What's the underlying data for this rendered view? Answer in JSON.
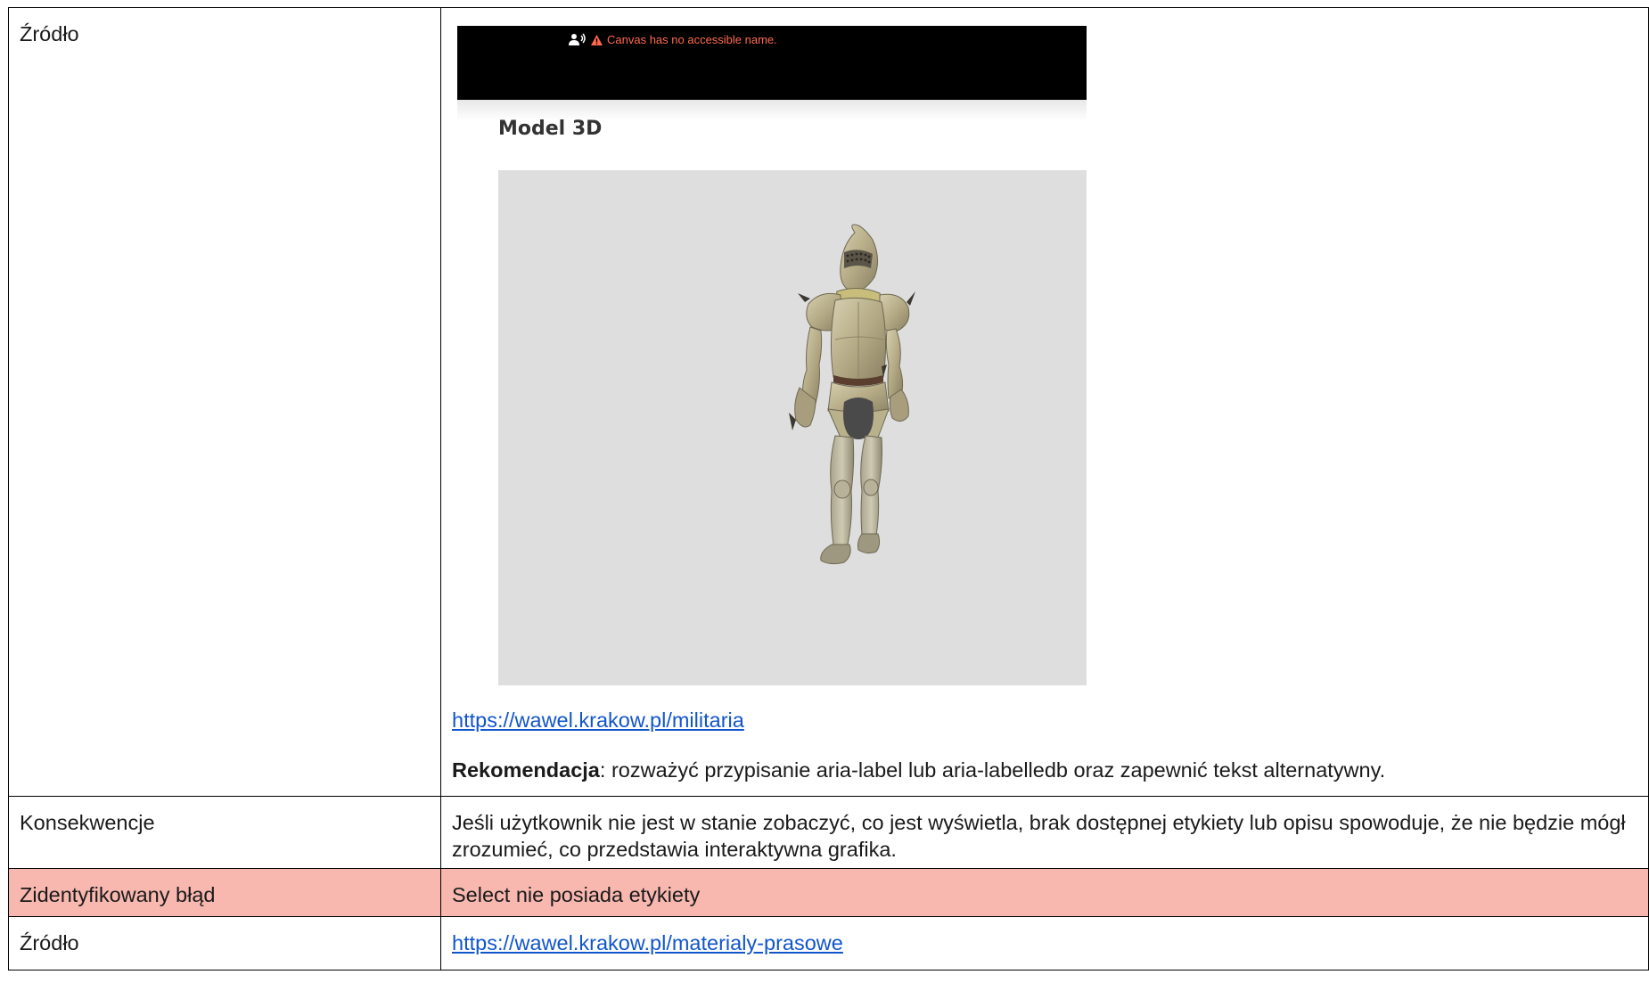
{
  "rows": [
    {
      "label": "Źródło",
      "screenshot": {
        "warning_text": "Canvas has no accessible name.",
        "heading": "Model 3D"
      },
      "link_text": "https://wawel.krakow.pl/militaria",
      "recommendation_label": "Rekomendacja",
      "recommendation_text": ": rozważyć przypisanie aria-label lub aria-labelledb oraz zapewnić tekst alternatywny."
    },
    {
      "label": "Konsekwencje",
      "text": "Jeśli użytkownik nie jest w stanie zobaczyć, co jest wyświetla, brak dostępnej etykiety lub opisu spowoduje, że nie będzie mógł zrozumieć, co przedstawia interaktywna grafika."
    },
    {
      "label": "Zidentyfikowany błąd",
      "text": "Select nie posiada etykiety",
      "highlight_color": "#f8b8b0"
    },
    {
      "label": "Źródło",
      "link_text": "https://wawel.krakow.pl/materialy-prasowe"
    }
  ],
  "icons": {
    "accessibility": "person-sound-icon",
    "alert": "warning-triangle-icon",
    "model": "armor-3d-model-image"
  },
  "colors": {
    "link": "#1155cc",
    "warning": "#ff6a4d",
    "viewer_bg": "#dedede"
  }
}
